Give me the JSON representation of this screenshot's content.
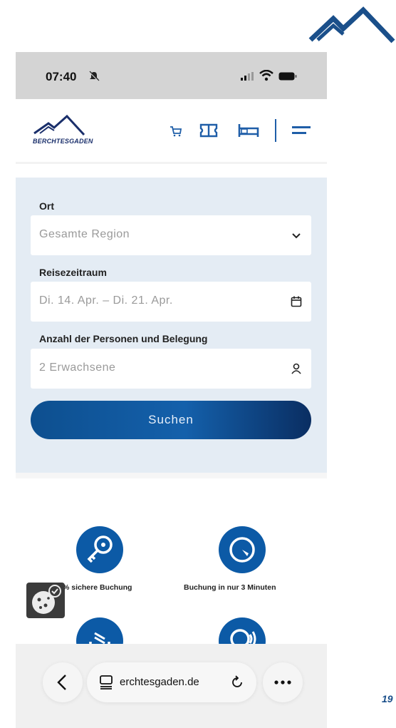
{
  "status_bar": {
    "time": "07:40"
  },
  "header": {
    "brand_name": "BERCHTESGADEN"
  },
  "search": {
    "location_label": "Ort",
    "location_value": "Gesamte Region",
    "period_label": "Reisezeitraum",
    "period_value": "Di. 14. Apr. – Di. 21. Apr.",
    "guests_label": "Anzahl der Personen und Belegung",
    "guests_value": "2 Erwachsene",
    "submit_label": "Suchen"
  },
  "features": [
    {
      "label": "% sichere Buchung",
      "icon": "key-icon"
    },
    {
      "label": "Buchung in nur 3 Minuten",
      "icon": "clock-icon"
    },
    {
      "label": "",
      "icon": "document-icon"
    },
    {
      "label": "",
      "icon": "support-icon"
    }
  ],
  "browser": {
    "domain": "erchtesgaden.de"
  },
  "page_number": "19",
  "colors": {
    "primary": "#0c5aa6",
    "panel_bg": "#e4ecf4",
    "brand_dark": "#1a2f6b"
  }
}
